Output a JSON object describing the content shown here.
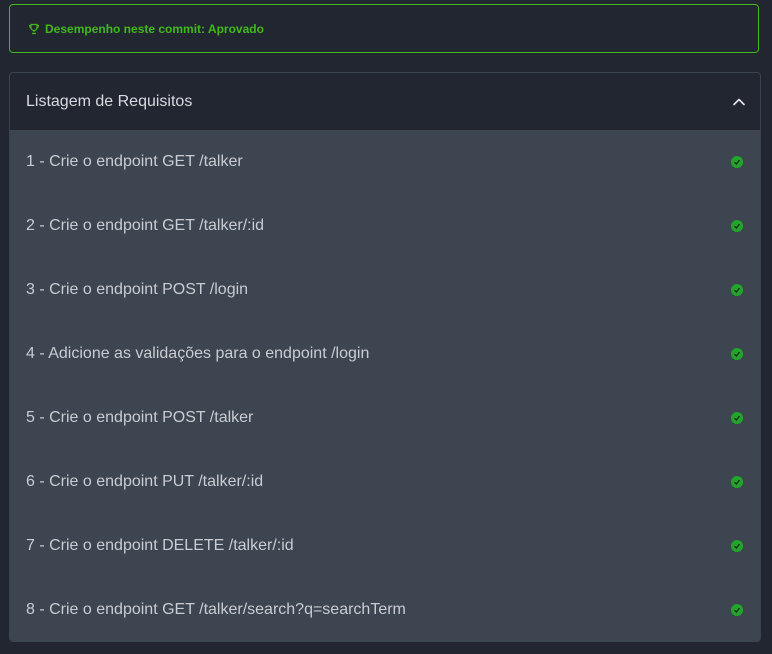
{
  "status": {
    "text": "Desempenho neste commit: Aprovado",
    "icon": "trophy-icon",
    "color": "#3fb91b"
  },
  "requirements_panel": {
    "title": "Listagem de Requisitos",
    "expanded": true,
    "toggle_icon": "chevron-up-icon",
    "items": [
      {
        "label": "1 - Crie o endpoint GET /talker",
        "status": "passed"
      },
      {
        "label": "2 - Crie o endpoint GET /talker/:id",
        "status": "passed"
      },
      {
        "label": "3 - Crie o endpoint POST /login",
        "status": "passed"
      },
      {
        "label": "4 - Adicione as validações para o endpoint /login",
        "status": "passed"
      },
      {
        "label": "5 - Crie o endpoint POST /talker",
        "status": "passed"
      },
      {
        "label": "6 - Crie o endpoint PUT /talker/:id",
        "status": "passed"
      },
      {
        "label": "7 - Crie o endpoint DELETE /talker/:id",
        "status": "passed"
      },
      {
        "label": "8 - Crie o endpoint GET /talker/search?q=searchTerm",
        "status": "passed"
      }
    ],
    "status_icon": "check-circle-icon",
    "passed_color": "#22a52a"
  }
}
